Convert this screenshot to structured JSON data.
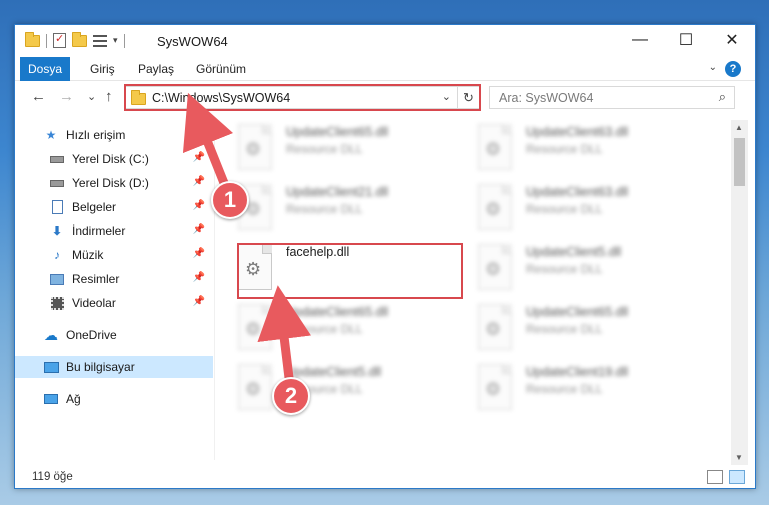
{
  "window": {
    "title": "SysWOW64",
    "controls": {
      "minimize": "—",
      "maximize": "☐",
      "close": "✕"
    }
  },
  "ribbon": {
    "tabs": [
      "Dosya",
      "Giriş",
      "Paylaş",
      "Görünüm"
    ],
    "help": "?"
  },
  "nav": {
    "back": "←",
    "forward": "→",
    "recent": "⌄",
    "up": "↑",
    "address": "C:\\Windows\\SysWOW64",
    "refresh": "↻",
    "search_placeholder": "Ara: SysWOW64"
  },
  "sidebar": {
    "quick_access": "Hızlı erişim",
    "items": [
      {
        "label": "Yerel Disk (C:)",
        "icon": "drive-icon"
      },
      {
        "label": "Yerel Disk (D:)",
        "icon": "drive-icon"
      },
      {
        "label": "Belgeler",
        "icon": "documents-icon"
      },
      {
        "label": "İndirmeler",
        "icon": "downloads-icon"
      },
      {
        "label": "Müzik",
        "icon": "music-icon"
      },
      {
        "label": "Resimler",
        "icon": "pictures-icon"
      },
      {
        "label": "Videolar",
        "icon": "videos-icon"
      }
    ],
    "onedrive": "OneDrive",
    "this_pc": "Bu bilgisayar",
    "network": "Ağ"
  },
  "files": {
    "left": [
      {
        "name": "UpdateClient65.dll",
        "type": "Resource DLL"
      },
      {
        "name": "UpdateClient21.dll",
        "type": "Resource DLL"
      },
      {
        "name": "facehelp.dll",
        "type": ""
      },
      {
        "name": "UpdateClient65.dll",
        "type": "Resource DLL"
      },
      {
        "name": "UpdateClient5.dll",
        "type": "Resource DLL"
      }
    ],
    "right": [
      {
        "name": "UpdateClient63.dll",
        "type": "Resource DLL"
      },
      {
        "name": "UpdateClient63.dll",
        "type": "Resource DLL"
      },
      {
        "name": "UpdateClient5.dll",
        "type": "Resource DLL"
      },
      {
        "name": "UpdateClient65.dll",
        "type": "Resource DLL"
      },
      {
        "name": "UpdateClient19.dll",
        "type": "Resource DLL"
      }
    ]
  },
  "status": {
    "count": "119 öğe"
  },
  "annotations": {
    "step1": "1",
    "step2": "2",
    "color": "#e85a5e"
  }
}
